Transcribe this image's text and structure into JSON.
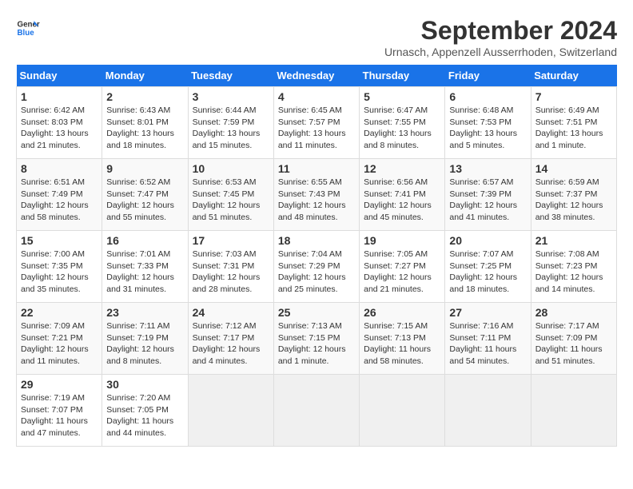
{
  "logo": {
    "general": "General",
    "blue": "Blue"
  },
  "title": "September 2024",
  "location": "Urnasch, Appenzell Ausserrhoden, Switzerland",
  "weekdays": [
    "Sunday",
    "Monday",
    "Tuesday",
    "Wednesday",
    "Thursday",
    "Friday",
    "Saturday"
  ],
  "weeks": [
    [
      {
        "day": "1",
        "sunrise": "6:42 AM",
        "sunset": "8:03 PM",
        "daylight": "13 hours and 21 minutes."
      },
      {
        "day": "2",
        "sunrise": "6:43 AM",
        "sunset": "8:01 PM",
        "daylight": "13 hours and 18 minutes."
      },
      {
        "day": "3",
        "sunrise": "6:44 AM",
        "sunset": "7:59 PM",
        "daylight": "13 hours and 15 minutes."
      },
      {
        "day": "4",
        "sunrise": "6:45 AM",
        "sunset": "7:57 PM",
        "daylight": "13 hours and 11 minutes."
      },
      {
        "day": "5",
        "sunrise": "6:47 AM",
        "sunset": "7:55 PM",
        "daylight": "13 hours and 8 minutes."
      },
      {
        "day": "6",
        "sunrise": "6:48 AM",
        "sunset": "7:53 PM",
        "daylight": "13 hours and 5 minutes."
      },
      {
        "day": "7",
        "sunrise": "6:49 AM",
        "sunset": "7:51 PM",
        "daylight": "13 hours and 1 minute."
      }
    ],
    [
      {
        "day": "8",
        "sunrise": "6:51 AM",
        "sunset": "7:49 PM",
        "daylight": "12 hours and 58 minutes."
      },
      {
        "day": "9",
        "sunrise": "6:52 AM",
        "sunset": "7:47 PM",
        "daylight": "12 hours and 55 minutes."
      },
      {
        "day": "10",
        "sunrise": "6:53 AM",
        "sunset": "7:45 PM",
        "daylight": "12 hours and 51 minutes."
      },
      {
        "day": "11",
        "sunrise": "6:55 AM",
        "sunset": "7:43 PM",
        "daylight": "12 hours and 48 minutes."
      },
      {
        "day": "12",
        "sunrise": "6:56 AM",
        "sunset": "7:41 PM",
        "daylight": "12 hours and 45 minutes."
      },
      {
        "day": "13",
        "sunrise": "6:57 AM",
        "sunset": "7:39 PM",
        "daylight": "12 hours and 41 minutes."
      },
      {
        "day": "14",
        "sunrise": "6:59 AM",
        "sunset": "7:37 PM",
        "daylight": "12 hours and 38 minutes."
      }
    ],
    [
      {
        "day": "15",
        "sunrise": "7:00 AM",
        "sunset": "7:35 PM",
        "daylight": "12 hours and 35 minutes."
      },
      {
        "day": "16",
        "sunrise": "7:01 AM",
        "sunset": "7:33 PM",
        "daylight": "12 hours and 31 minutes."
      },
      {
        "day": "17",
        "sunrise": "7:03 AM",
        "sunset": "7:31 PM",
        "daylight": "12 hours and 28 minutes."
      },
      {
        "day": "18",
        "sunrise": "7:04 AM",
        "sunset": "7:29 PM",
        "daylight": "12 hours and 25 minutes."
      },
      {
        "day": "19",
        "sunrise": "7:05 AM",
        "sunset": "7:27 PM",
        "daylight": "12 hours and 21 minutes."
      },
      {
        "day": "20",
        "sunrise": "7:07 AM",
        "sunset": "7:25 PM",
        "daylight": "12 hours and 18 minutes."
      },
      {
        "day": "21",
        "sunrise": "7:08 AM",
        "sunset": "7:23 PM",
        "daylight": "12 hours and 14 minutes."
      }
    ],
    [
      {
        "day": "22",
        "sunrise": "7:09 AM",
        "sunset": "7:21 PM",
        "daylight": "12 hours and 11 minutes."
      },
      {
        "day": "23",
        "sunrise": "7:11 AM",
        "sunset": "7:19 PM",
        "daylight": "12 hours and 8 minutes."
      },
      {
        "day": "24",
        "sunrise": "7:12 AM",
        "sunset": "7:17 PM",
        "daylight": "12 hours and 4 minutes."
      },
      {
        "day": "25",
        "sunrise": "7:13 AM",
        "sunset": "7:15 PM",
        "daylight": "12 hours and 1 minute."
      },
      {
        "day": "26",
        "sunrise": "7:15 AM",
        "sunset": "7:13 PM",
        "daylight": "11 hours and 58 minutes."
      },
      {
        "day": "27",
        "sunrise": "7:16 AM",
        "sunset": "7:11 PM",
        "daylight": "11 hours and 54 minutes."
      },
      {
        "day": "28",
        "sunrise": "7:17 AM",
        "sunset": "7:09 PM",
        "daylight": "11 hours and 51 minutes."
      }
    ],
    [
      {
        "day": "29",
        "sunrise": "7:19 AM",
        "sunset": "7:07 PM",
        "daylight": "11 hours and 47 minutes."
      },
      {
        "day": "30",
        "sunrise": "7:20 AM",
        "sunset": "7:05 PM",
        "daylight": "11 hours and 44 minutes."
      },
      null,
      null,
      null,
      null,
      null
    ]
  ]
}
